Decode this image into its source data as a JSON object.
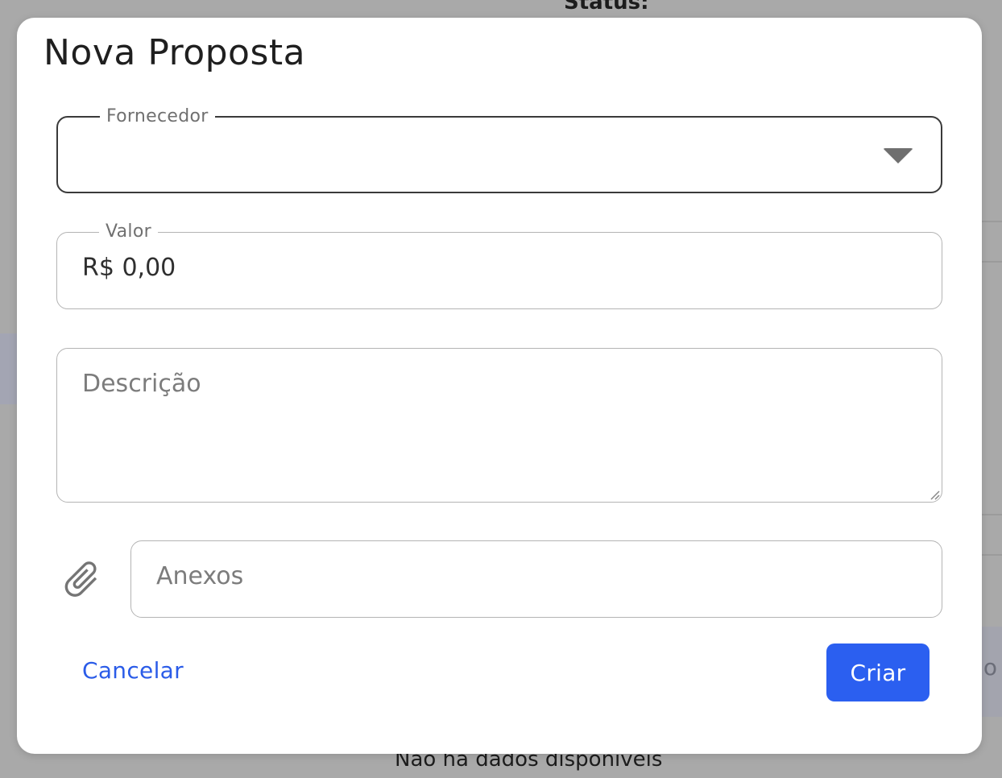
{
  "background": {
    "status_label": "Status:",
    "no_data_text": "Não há dados disponíveis",
    "trailing_char": "o"
  },
  "dialog": {
    "title": "Nova Proposta",
    "fields": {
      "fornecedor": {
        "label": "Fornecedor",
        "value": ""
      },
      "valor": {
        "label": "Valor",
        "value": "R$ 0,00"
      },
      "descricao": {
        "placeholder": "Descrição",
        "value": ""
      },
      "anexos": {
        "placeholder": "Anexos"
      }
    },
    "icons": {
      "dropdown": "chevron-down-icon",
      "attachment": "paperclip-icon",
      "resize": "resize-handle-icon"
    },
    "actions": {
      "cancel_label": "Cancelar",
      "create_label": "Criar"
    }
  },
  "colors": {
    "primary": "#2b5ff0",
    "link": "#2b5ce8",
    "overlay": "#a9a9a9"
  }
}
